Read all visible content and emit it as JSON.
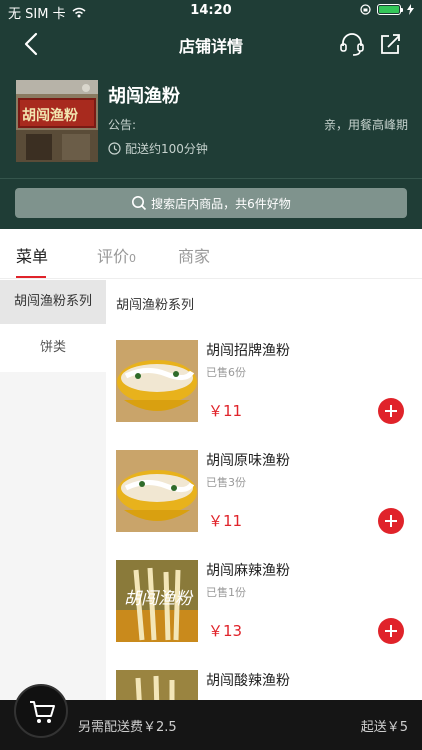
{
  "status_bar": {
    "carrier": "无 SIM 卡",
    "time": "14:20"
  },
  "nav": {
    "title": "店铺详情"
  },
  "store": {
    "name": "胡闯渔粉",
    "notice_label": "公告:",
    "notice_text": "亲，用餐高峰期",
    "delivery": "配送约100分钟",
    "search_placeholder": "搜索店内商品，共6件好物"
  },
  "tabs": [
    {
      "label": "菜单",
      "count": ""
    },
    {
      "label": "评价",
      "count": "0"
    },
    {
      "label": "商家",
      "count": ""
    }
  ],
  "categories": [
    "胡闯渔粉系列",
    "饼类"
  ],
  "section_title": "胡闯渔粉系列",
  "products": [
    {
      "name": "胡闯招牌渔粉",
      "sold": "已售6份",
      "price": "￥11"
    },
    {
      "name": "胡闯原味渔粉",
      "sold": "已售3份",
      "price": "￥11"
    },
    {
      "name": "胡闯麻辣渔粉",
      "sold": "已售1份",
      "price": "￥13"
    },
    {
      "name": "胡闯酸辣渔粉",
      "sold": "",
      "price": ""
    }
  ],
  "bottom": {
    "extra_fee": "另需配送费￥2.5",
    "min_order": "起送￥5"
  },
  "colors": {
    "header": "#1f3d36",
    "accent": "#e0232a",
    "bottom_bar": "#151515"
  }
}
